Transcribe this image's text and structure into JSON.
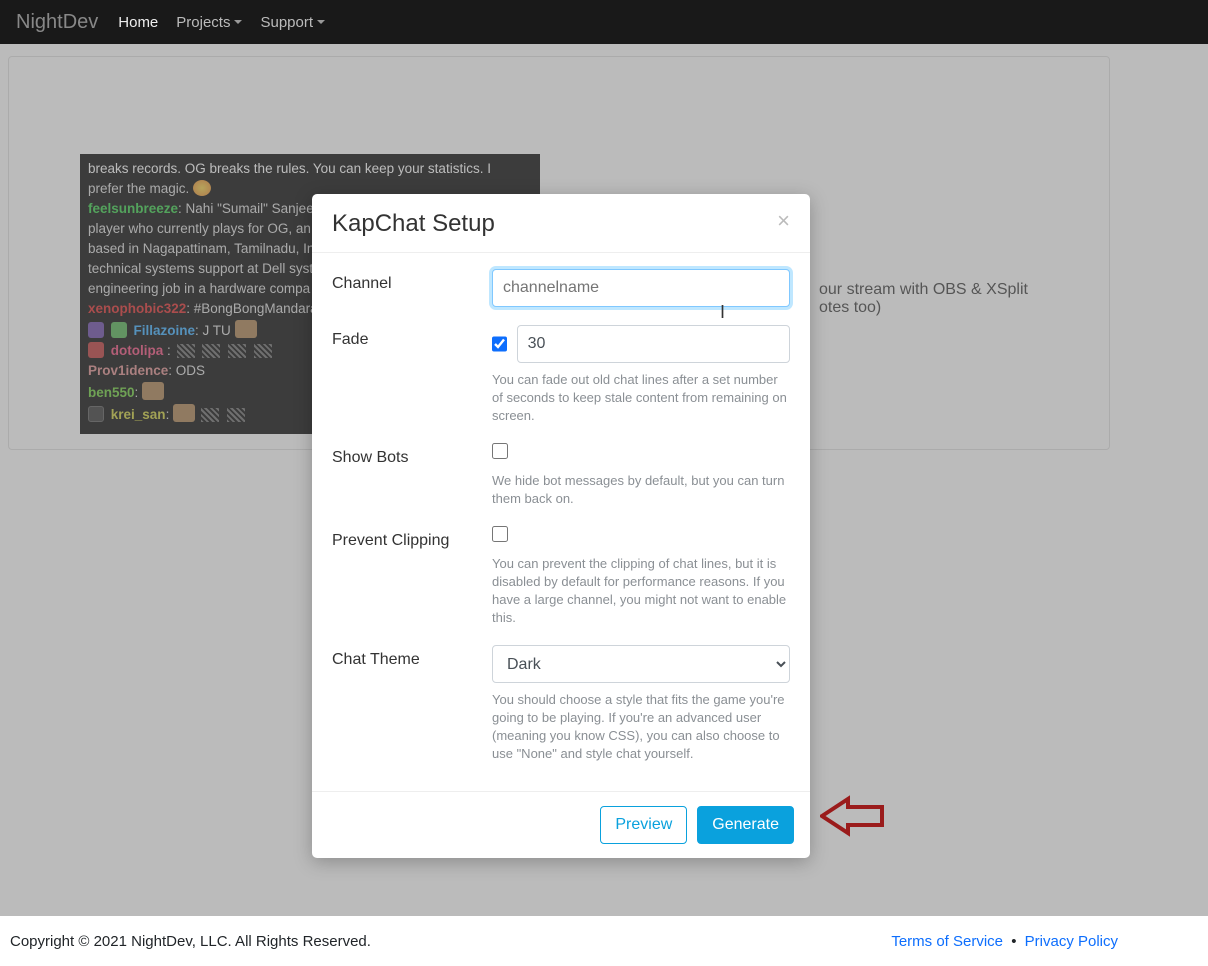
{
  "nav": {
    "brand": "NightDev",
    "home": "Home",
    "projects": "Projects",
    "support": "Support"
  },
  "side": {
    "line1": "our stream with OBS & XSplit",
    "line2": "otes too)"
  },
  "chat": {
    "top_cut": "breaks records. OG breaks the rules. You can keep your statistics. I",
    "top2": "prefer the magic.",
    "l1_user": "feelsunbreeze",
    "l1_msg_a": ": Nahi \"Sumail\" Sanjee",
    "l1_msg_b": "player who currently plays for OG, an",
    "l1_msg_c": "based in Nagapattinam, Tamilnadu, In",
    "l1_msg_d": "technical systems support at Dell syst",
    "l1_msg_e": "engineering job in a hardware compa",
    "l2_user": "xenophobic322",
    "l2_msg": ": #BongBongMandara",
    "l3_user": "Fillazoine",
    "l3_msg": ": J TU",
    "l4_user": "dotolipa",
    "l5_user": "Prov1idence",
    "l5_msg": ": ODS",
    "l6_user": "ben550",
    "l6_msg": ":",
    "l7_user": "krei_san",
    "l7_msg": ":"
  },
  "modal": {
    "title": "KapChat Setup",
    "channel_label": "Channel",
    "channel_placeholder": "channelname",
    "channel_value": "",
    "fade_label": "Fade",
    "fade_checked": true,
    "fade_value": "30",
    "fade_help": "You can fade out old chat lines after a set number of seconds to keep stale content from remaining on screen.",
    "showbots_label": "Show Bots",
    "showbots_checked": false,
    "showbots_help": "We hide bot messages by default, but you can turn them back on.",
    "clip_label": "Prevent Clipping",
    "clip_checked": false,
    "clip_help": "You can prevent the clipping of chat lines, but it is disabled by default for performance reasons. If you have a large channel, you might not want to enable this.",
    "theme_label": "Chat Theme",
    "theme_value": "Dark",
    "theme_help": "You should choose a style that fits the game you're going to be playing. If you're an advanced user (meaning you know CSS), you can also choose to use \"None\" and style chat yourself.",
    "preview": "Preview",
    "generate": "Generate"
  },
  "footer": {
    "copyright": "Copyright © 2021 NightDev, LLC. All Rights Reserved.",
    "tos": "Terms of Service",
    "privacy": "Privacy Policy"
  }
}
